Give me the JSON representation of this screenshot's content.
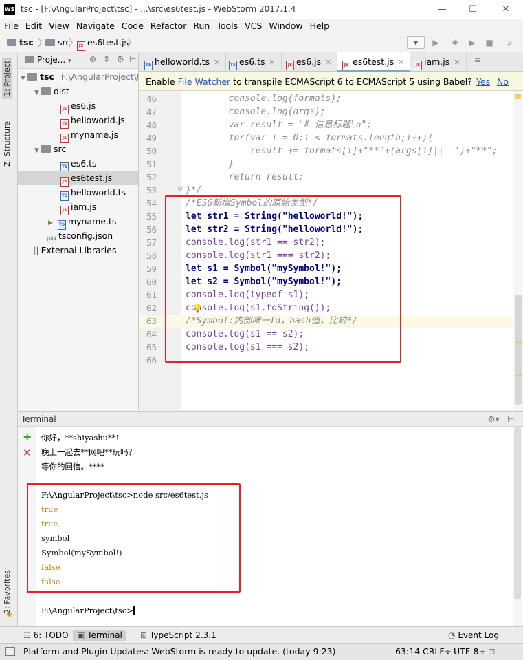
{
  "window": {
    "app_logo": "WS",
    "title": "tsc - [F:\\AngularProject\\tsc] - ...\\src\\es6test.js - WebStorm 2017.1.4"
  },
  "menu": [
    "File",
    "Edit",
    "View",
    "Navigate",
    "Code",
    "Refactor",
    "Run",
    "Tools",
    "VCS",
    "Window",
    "Help"
  ],
  "breadcrumb": {
    "project": "tsc",
    "folder": "src",
    "file": "es6test.js"
  },
  "project_panel": {
    "header": "Proje...",
    "root_name": "tsc",
    "root_path": "F:\\AngularProject\\t",
    "items": [
      {
        "name": "dist",
        "type": "folder"
      },
      {
        "name": "es6.js",
        "type": "js"
      },
      {
        "name": "helloworld.js",
        "type": "js"
      },
      {
        "name": "myname.js",
        "type": "js"
      },
      {
        "name": "src",
        "type": "folder"
      },
      {
        "name": "es6.ts",
        "type": "ts"
      },
      {
        "name": "es6test.js",
        "type": "js"
      },
      {
        "name": "helloworld.ts",
        "type": "ts"
      },
      {
        "name": "iam.js",
        "type": "js"
      },
      {
        "name": "myname.ts",
        "type": "ts"
      },
      {
        "name": "tsconfig.json",
        "type": "json"
      },
      {
        "name": "External Libraries",
        "type": "lib"
      }
    ]
  },
  "side_tabs": {
    "project": "1: Project",
    "structure": "Z: Structure",
    "favorites": "2: Favorites"
  },
  "tabs": [
    "helloworld.ts",
    "es6.ts",
    "es6.js",
    "es6test.js",
    "iam.js"
  ],
  "banner": {
    "prefix": "Enable ",
    "link": "File Watcher",
    "suffix": " to transpile ECMAScript 6 to ECMAScript 5 using Babel?",
    "yes": "Yes",
    "no": "No"
  },
  "editor": {
    "line_numbers": [
      "46",
      "47",
      "48",
      "49",
      "50",
      "51",
      "52",
      "53",
      "54",
      "55",
      "56",
      "57",
      "58",
      "59",
      "60",
      "61",
      "62",
      "63",
      "64",
      "65",
      "66"
    ],
    "lines": [
      "        console.log(formats);",
      "        console.log(args);",
      "        var result = \"# 信息标题\\n\";",
      "        for(var i = 0;i < formats.length;i++){",
      "            result += formats[i]+\"**\"+(args[i]|| '')+\"**\";",
      "        }",
      "        return result;",
      "}*/",
      "/*ES6新增Symbol的原始类型*/",
      "let str1 = String(\"helloworld!\");",
      "let str2 = String(\"helloworld!\");",
      "console.log(str1 == str2);",
      "console.log(str1 === str2);",
      "let s1 = Symbol(\"mySymbol!\");",
      "let s2 = Symbol(\"mySymbol!\");",
      "console.log(typeof s1);",
      "console.log(s1.toString());",
      "/*Symbol:内部唯一Id，hash值，比较*/",
      "console.log(s1 == s2);",
      "console.log(s1 === s2);",
      ""
    ]
  },
  "terminal": {
    "title": "Terminal",
    "lines": [
      "你好，**shiyashu**!",
      "晚上一起去**网吧**玩吗？",
      "等你的回信。****",
      "",
      "F:\\AngularProject\\tsc>node src/es6test.js",
      "true",
      "true",
      "symbol",
      "Symbol(mySymbol!)",
      "false",
      "false",
      "",
      "F:\\AngularProject\\tsc>"
    ]
  },
  "bottom_tools": {
    "todo": "6: TODO",
    "terminal": "Terminal",
    "typescript": "TypeScript 2.3.1",
    "event_log": "Event Log"
  },
  "status": {
    "message": "Platform and Plugin Updates: WebStorm is ready to update. (today 9:23)",
    "position": "63:14",
    "line_sep": "CRLF÷",
    "encoding": "UTF-8÷"
  }
}
